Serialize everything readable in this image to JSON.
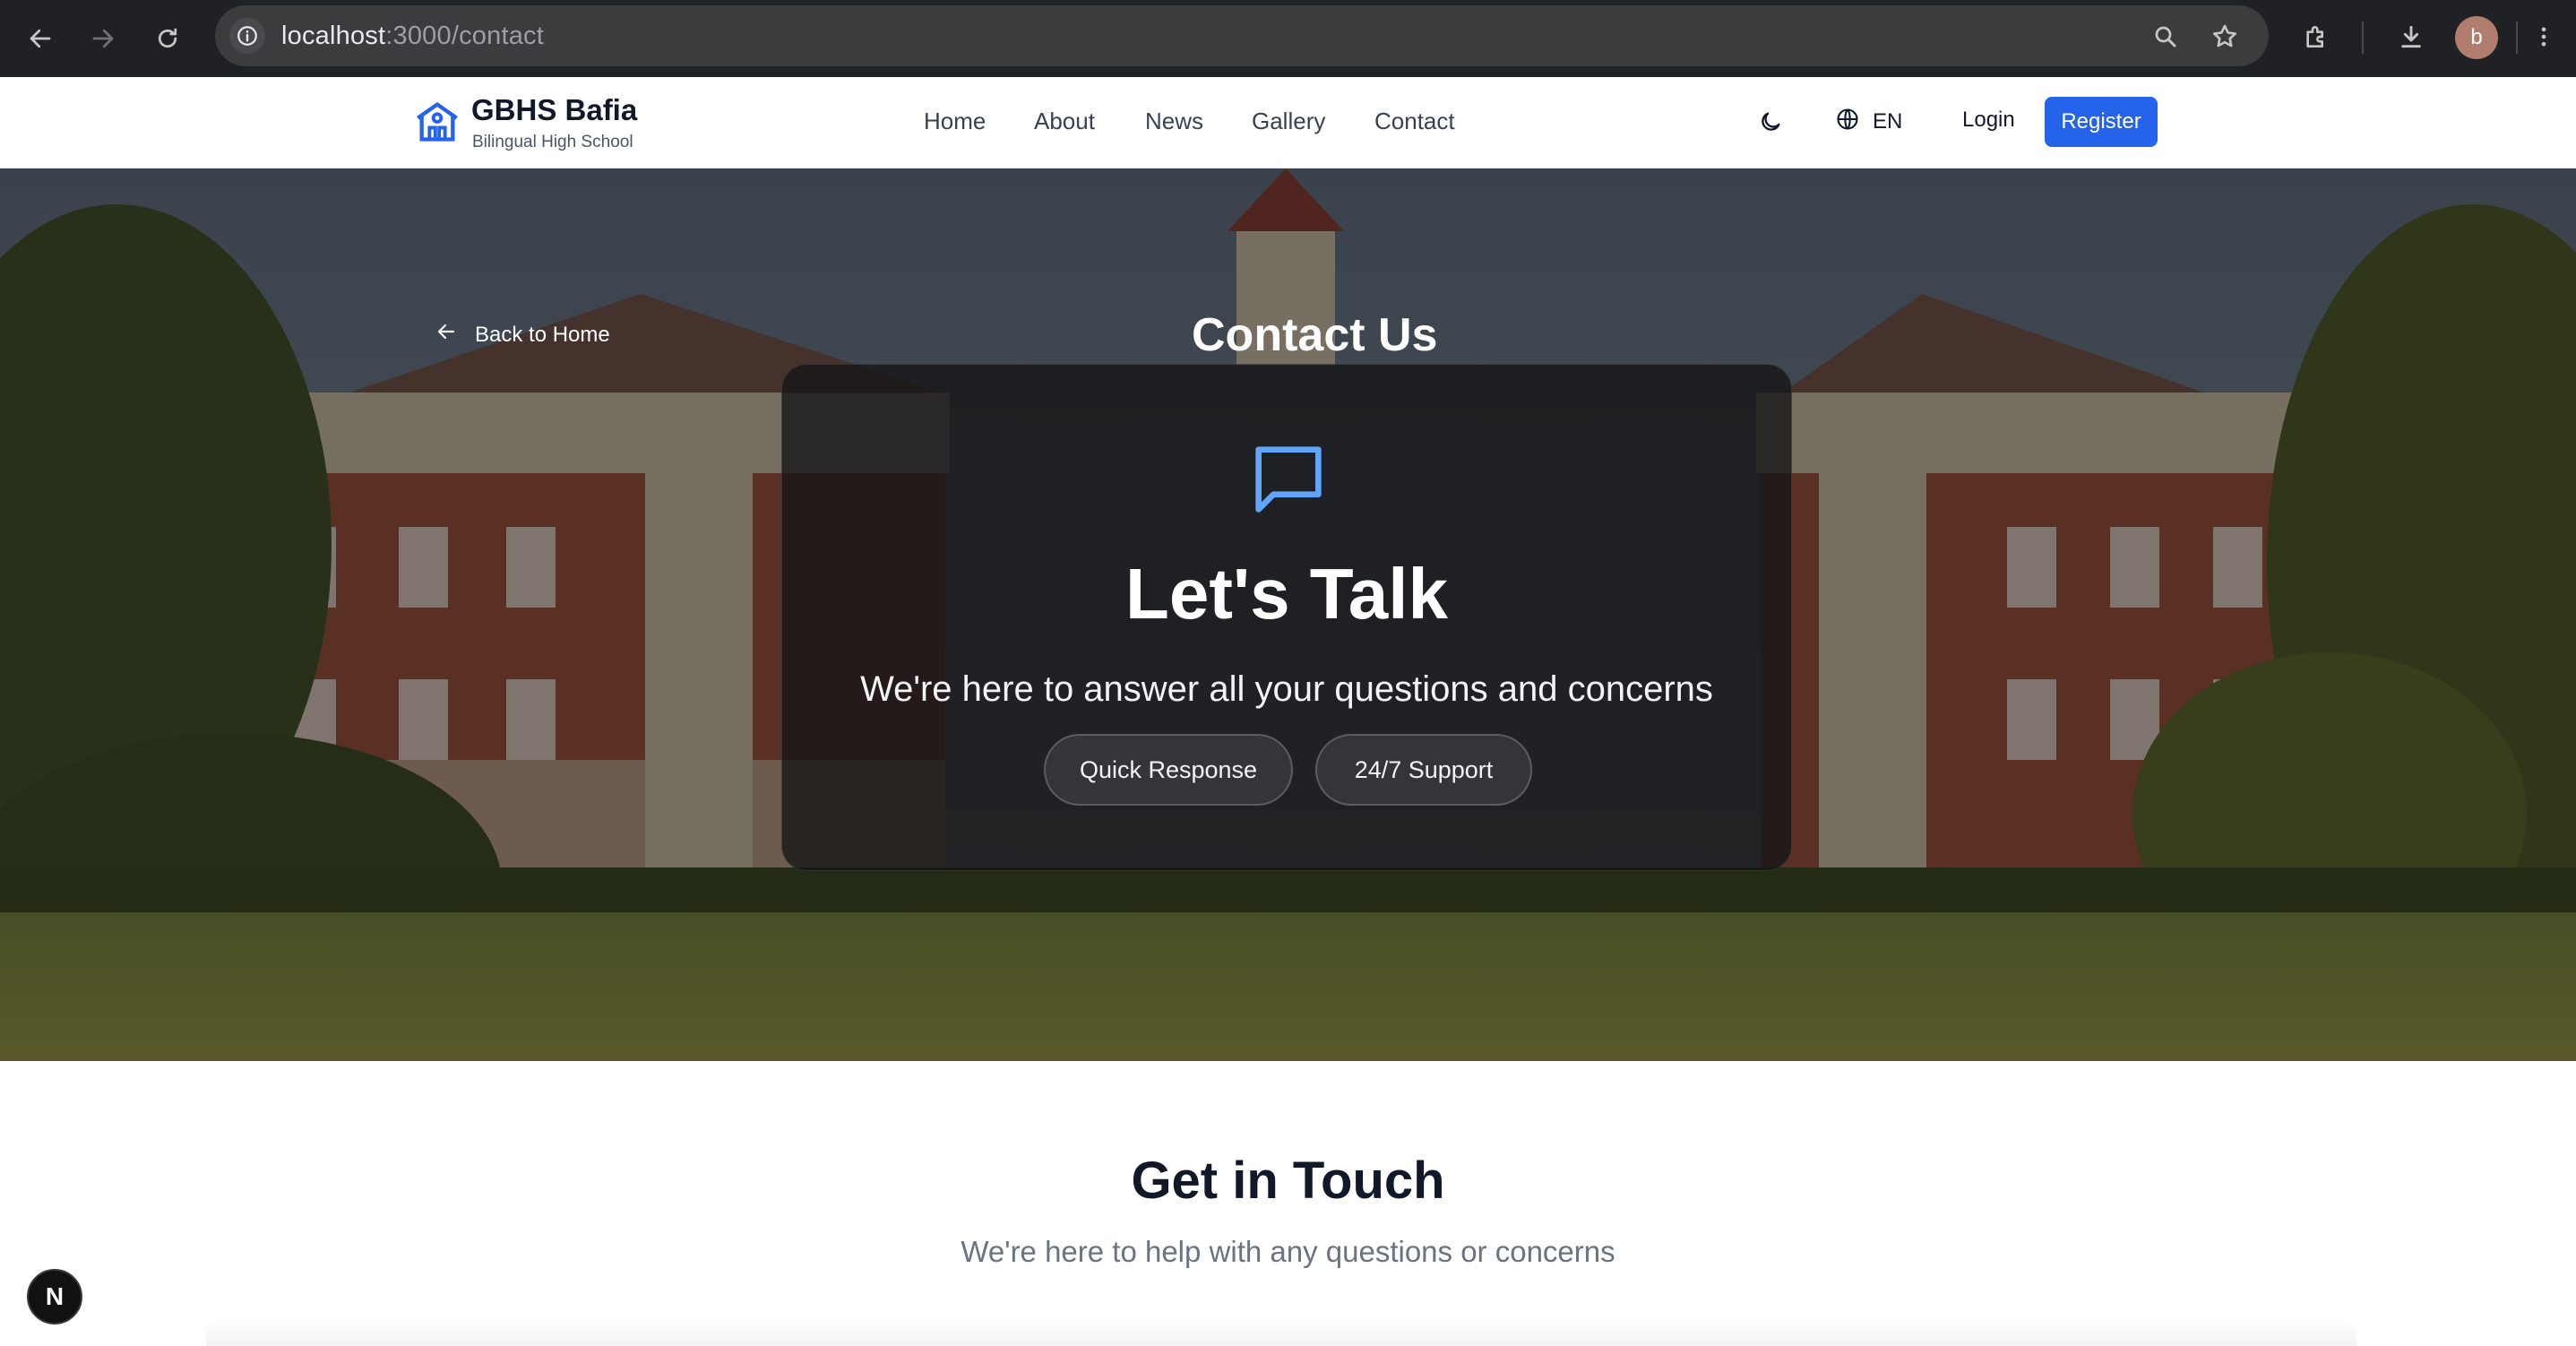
{
  "browser": {
    "url_host": "localhost",
    "url_path": ":3000/contact",
    "profile_initial": "b",
    "icons": [
      "back-arrow-icon",
      "forward-arrow-icon",
      "reload-icon",
      "site-info-icon",
      "zoom-icon",
      "bookmark-star-icon",
      "extensions-icon",
      "download-icon",
      "more-menu-icon"
    ]
  },
  "header": {
    "brand_name": "GBHS Bafia",
    "brand_subtitle": "Bilingual High School",
    "nav": [
      "Home",
      "About",
      "News",
      "Gallery",
      "Contact"
    ],
    "language": "EN",
    "login": "Login",
    "register": "Register",
    "accent_color": "#2563eb"
  },
  "hero": {
    "back_label": "Back to Home",
    "title": "Contact Us",
    "card_heading": "Let's Talk",
    "card_lead": "We're here to answer all your questions and concerns",
    "badges": [
      "Quick Response",
      "24/7 Support"
    ]
  },
  "section": {
    "title": "Get in Touch",
    "subtitle": "We're here to help with any questions or concerns"
  },
  "dev_badge": "N"
}
